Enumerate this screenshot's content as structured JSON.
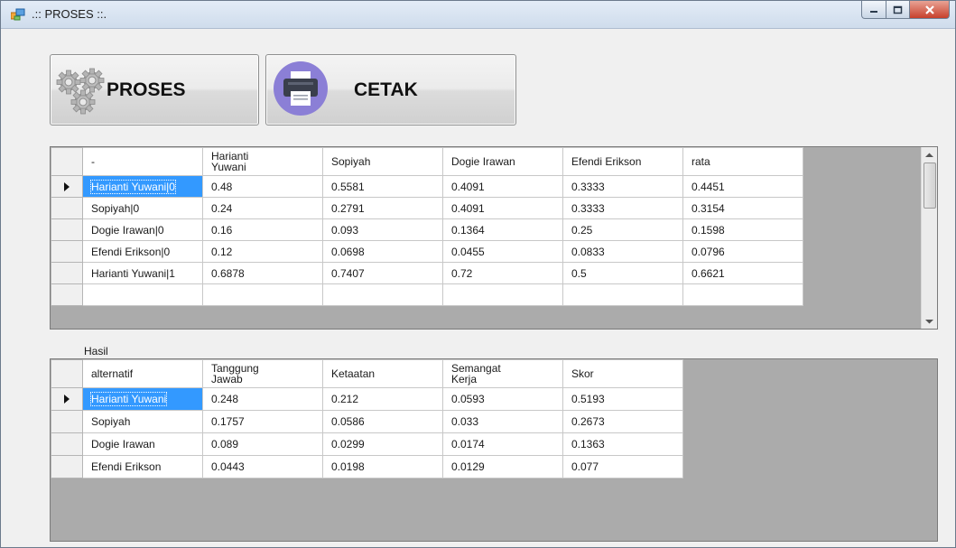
{
  "window": {
    "title": ".:: PROSES ::."
  },
  "toolbar": {
    "proses_label": "PROSES",
    "cetak_label": "CETAK"
  },
  "icons": {
    "proses": "gears-icon",
    "cetak": "printer-icon",
    "app": "app-window-icon"
  },
  "grid1": {
    "columns": [
      "-",
      "Harianti\nYuwani",
      "Sopiyah",
      "Dogie Irawan",
      "Efendi Erikson",
      "rata"
    ],
    "rows": [
      [
        "Harianti Yuwani|0",
        "0.48",
        "0.5581",
        "0.4091",
        "0.3333",
        "0.4451"
      ],
      [
        "Sopiyah|0",
        "0.24",
        "0.2791",
        "0.4091",
        "0.3333",
        "0.3154"
      ],
      [
        "Dogie Irawan|0",
        "0.16",
        "0.093",
        "0.1364",
        "0.25",
        "0.1598"
      ],
      [
        "Efendi Erikson|0",
        "0.12",
        "0.0698",
        "0.0455",
        "0.0833",
        "0.0796"
      ],
      [
        "Harianti Yuwani|1",
        "0.6878",
        "0.7407",
        "0.72",
        "0.5",
        "0.6621"
      ]
    ]
  },
  "hasil_label": "Hasil",
  "grid2": {
    "columns": [
      "alternatif",
      "Tanggung\nJawab",
      "Ketaatan",
      "Semangat\nKerja",
      "Skor"
    ],
    "rows": [
      [
        "Harianti Yuwani",
        "0.248",
        "0.212",
        "0.0593",
        "0.5193"
      ],
      [
        "Sopiyah",
        "0.1757",
        "0.0586",
        "0.033",
        "0.2673"
      ],
      [
        "Dogie Irawan",
        "0.089",
        "0.0299",
        "0.0174",
        "0.1363"
      ],
      [
        "Efendi Erikson",
        "0.0443",
        "0.0198",
        "0.0129",
        "0.077"
      ]
    ]
  },
  "colors": {
    "selection": "#3399ff",
    "grid_background": "#ababab"
  }
}
